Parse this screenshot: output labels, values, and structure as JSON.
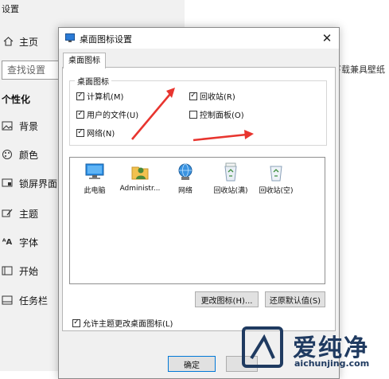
{
  "settings": {
    "title": "设置",
    "home": "主页",
    "search_placeholder": "查找设置",
    "section": "个性化",
    "items": [
      {
        "label": "背景",
        "icon": "picture-icon"
      },
      {
        "label": "颜色",
        "icon": "palette-icon"
      },
      {
        "label": "锁屏界面",
        "icon": "lock-screen-icon"
      },
      {
        "label": "主题",
        "icon": "brush-icon"
      },
      {
        "label": "字体",
        "icon": "font-icon"
      },
      {
        "label": "开始",
        "icon": "start-icon"
      },
      {
        "label": "任务栏",
        "icon": "taskbar-icon"
      }
    ],
    "background_text": "下载兼具壁纸"
  },
  "dialog": {
    "title": "桌面图标设置",
    "tab": "桌面图标",
    "group_title": "桌面图标",
    "checkboxes": [
      {
        "label": "计算机(M)",
        "checked": true
      },
      {
        "label": "回收站(R)",
        "checked": true
      },
      {
        "label": "用户的文件(U)",
        "checked": true
      },
      {
        "label": "控制面板(O)",
        "checked": false
      },
      {
        "label": "网络(N)",
        "checked": true
      }
    ],
    "icons": [
      {
        "label": "此电脑",
        "icon": "computer-icon"
      },
      {
        "label": "Administr...",
        "icon": "user-folder-icon"
      },
      {
        "label": "网络",
        "icon": "network-icon"
      },
      {
        "label": "回收站(满)",
        "icon": "recycle-bin-full-icon"
      },
      {
        "label": "回收站(空)",
        "icon": "recycle-bin-empty-icon"
      }
    ],
    "change_icon_button": "更改图标(H)...",
    "restore_default_button": "还原默认值(S)",
    "allow_themes_label": "允许主题更改桌面图标(L)",
    "allow_themes_checked": true,
    "ok_button": "确定"
  },
  "watermark": {
    "brand": "爱纯净",
    "url": "aichunjing.com"
  },
  "colors": {
    "arrow": "#e8352f",
    "accent": "#0078d7",
    "watermark": "#1f3a60"
  }
}
